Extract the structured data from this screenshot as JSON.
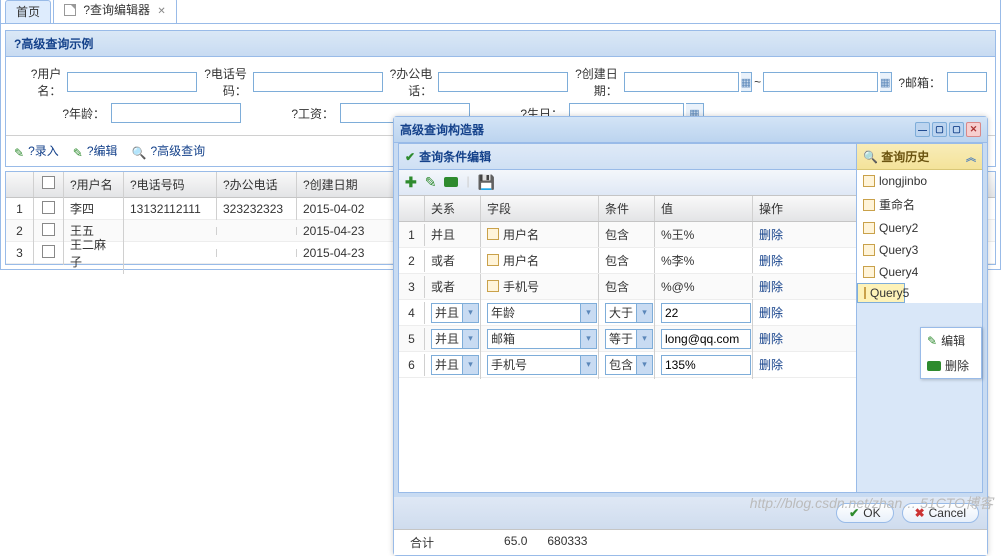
{
  "tabs": {
    "home": "首页",
    "editor": "?查询编辑器"
  },
  "form": {
    "title": "?高级查询示例",
    "labels": {
      "user": "?用户名：",
      "phone": "?电话号码：",
      "office": "?办公电话：",
      "created": "?创建日期：",
      "email": "?邮箱：",
      "age": "?年龄：",
      "salary": "?工资：",
      "birth": "?生日："
    },
    "sep": "~"
  },
  "toolbar": {
    "input": "?录入",
    "edit": "?编辑",
    "adv": "?高级查询"
  },
  "gridcols": {
    "user": "?用户名",
    "phone": "?电话号码",
    "office": "?办公电话",
    "created": "?创建日期"
  },
  "gridrows": [
    {
      "n": "1",
      "user": "李四",
      "phone": "13132112111",
      "office": "323232323",
      "created": "2015-04-02"
    },
    {
      "n": "2",
      "user": "王五",
      "phone": "",
      "office": "",
      "created": "2015-04-23"
    },
    {
      "n": "3",
      "user": "王二麻子",
      "phone": "",
      "office": "",
      "created": "2015-04-23"
    }
  ],
  "win": {
    "title": "高级查询构造器",
    "cond_title": "查询条件编辑",
    "cols": {
      "rel": "关系",
      "field": "字段",
      "cond": "条件",
      "val": "值",
      "op": "操作"
    },
    "rows_static": [
      {
        "n": "1",
        "rel": "并且",
        "field": "用户名",
        "cond": "包含",
        "val": "%王%",
        "op": "删除"
      },
      {
        "n": "2",
        "rel": "或者",
        "field": "用户名",
        "cond": "包含",
        "val": "%李%",
        "op": "删除"
      },
      {
        "n": "3",
        "rel": "或者",
        "field": "手机号",
        "cond": "包含",
        "val": "%@%",
        "op": "删除"
      }
    ],
    "rows_edit": [
      {
        "n": "4",
        "rel": "并且",
        "field": "年龄",
        "cond": "大于",
        "val": "22",
        "op": "删除"
      },
      {
        "n": "5",
        "rel": "并且",
        "field": "邮箱",
        "cond": "等于",
        "val": "long@qq.com",
        "op": "删除"
      },
      {
        "n": "6",
        "rel": "并且",
        "field": "手机号",
        "cond": "包含",
        "val": "135%",
        "op": "删除"
      }
    ],
    "history": {
      "title": "查询历史",
      "items": [
        "longjinbo",
        "重命名",
        "Query2",
        "Query3",
        "Query4",
        "Query5"
      ],
      "selindex": 5
    },
    "ctx": {
      "edit": "编辑",
      "del": "删除"
    },
    "ok": "OK",
    "cancel": "Cancel"
  },
  "summary": {
    "label": "合计",
    "v1": "65.0",
    "v2": "680333"
  },
  "watermark": "http://blog.csdn.net/zhan… 51CTO博客"
}
